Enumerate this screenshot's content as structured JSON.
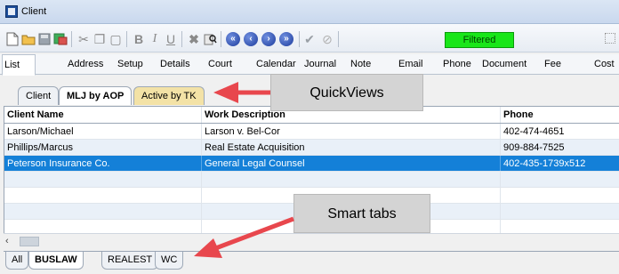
{
  "window": {
    "title": "Client"
  },
  "toolbar": {
    "filtered_label": "Filtered"
  },
  "module_tabs": [
    "List",
    "Address",
    "Setup",
    "Details",
    "Court",
    "Calendar",
    "Journal",
    "Note",
    "Email",
    "Phone",
    "Document",
    "Fee",
    "Cost"
  ],
  "quickviews": [
    "Client",
    "MLJ by AOP",
    "Active by TK"
  ],
  "grid": {
    "headers": {
      "client_name": "Client Name",
      "work_description": "Work Description",
      "phone": "Phone"
    },
    "rows": [
      {
        "client_name": "Larson/Michael",
        "work_description": "Larson v. Bel-Cor",
        "phone": "402-474-4651"
      },
      {
        "client_name": "Phillips/Marcus",
        "work_description": "Real Estate Acquisition",
        "phone": "909-884-7525"
      },
      {
        "client_name": "Peterson Insurance Co.",
        "work_description": "General Legal Counsel",
        "phone": "402-435-1739x512"
      }
    ]
  },
  "smart_tabs": [
    "All",
    "BUSLAW",
    "REALEST",
    "WC"
  ],
  "callouts": {
    "quickviews": "QuickViews",
    "smart_tabs": "Smart tabs"
  },
  "colors": {
    "selection": "#1480d8",
    "filtered": "#19e619",
    "arrow": "#e8474d"
  }
}
